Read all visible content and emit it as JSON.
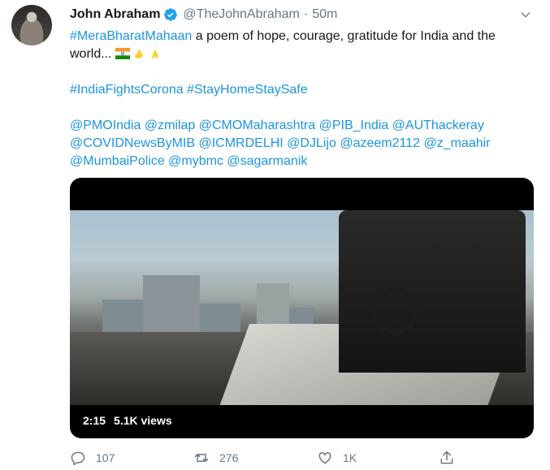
{
  "tweet": {
    "author": {
      "name": "John Abraham",
      "handle": "@TheJohnAbraham",
      "separator": "·",
      "time": "50m"
    },
    "text": {
      "line1_hashtag": "#MeraBharatMahaan",
      "line1_rest": " a poem of hope, courage, gratitude for India and the world...",
      "hashtags_line": "#IndiaFightsCorona #StayHomeStaySafe",
      "mentions": [
        "@PMOIndia @zmilap @CMOMaharashtra @PIB_India @AUThackeray",
        "@COVIDNewsByMIB @ICMRDELHI @DJLijo @azeem2112 @z_maahir",
        "@MumbaiPolice @mybmc @sagarmanik"
      ]
    },
    "video": {
      "duration": "2:15",
      "views": "5.1K views"
    },
    "stats": {
      "replies": "107",
      "retweets": "276",
      "likes": "1K"
    },
    "colors": {
      "link": "#1b95e0",
      "verified": "#1da1f2",
      "muted": "#657786"
    }
  }
}
